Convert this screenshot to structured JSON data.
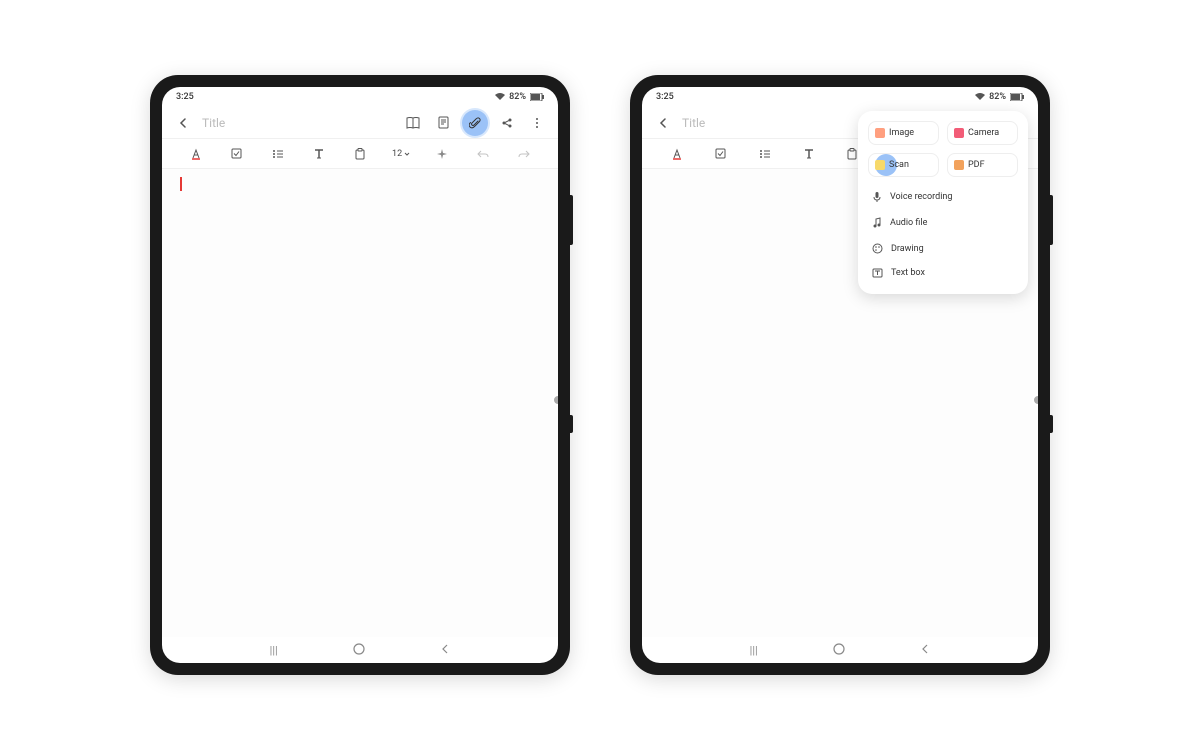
{
  "status": {
    "time": "3:25",
    "battery": "82%"
  },
  "title": {
    "placeholder": "Title"
  },
  "toolbar": {
    "fontSize": "12"
  },
  "attachMenu": {
    "cards": {
      "image": "Image",
      "camera": "Camera",
      "scan": "Scan",
      "pdf": "PDF"
    },
    "list": {
      "voice": "Voice recording",
      "audio": "Audio file",
      "drawing": "Drawing",
      "textbox": "Text box"
    }
  },
  "nav": {
    "recents": "|||",
    "home": "○",
    "back": "<"
  }
}
